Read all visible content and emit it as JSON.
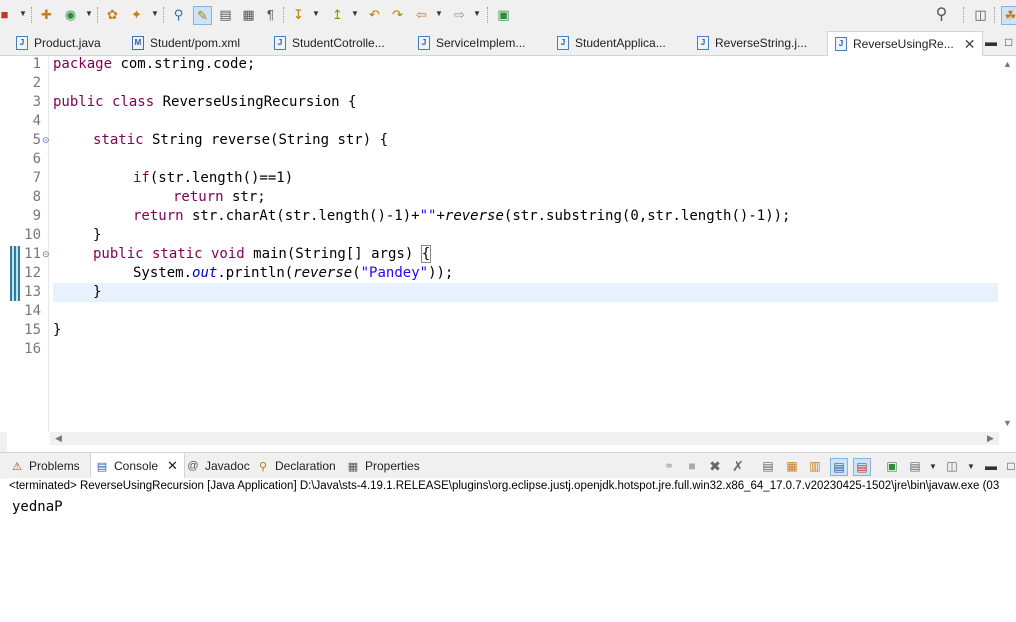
{
  "toolbar": {
    "icons": [
      "new-icon",
      "new-java-project-icon",
      "run-last-icon",
      "open-type-icon",
      "open-task-icon",
      "search-references-icon",
      "toggle-mark-occurrences-icon",
      "toggle-block-selection-icon",
      "show-whitespace-icon",
      "paragraph-icon",
      "next-annotation-icon",
      "prev-annotation-icon",
      "last-edit-icon",
      "back-icon",
      "forward-icon",
      "pin-editor-icon",
      "search-icon",
      "open-perspective-icon",
      "java-perspective-icon"
    ]
  },
  "editor_tabs": [
    {
      "label": "Product.java",
      "icon": "J"
    },
    {
      "label": "Student/pom.xml",
      "icon": "M"
    },
    {
      "label": "StudentCotrolle...",
      "icon": "J"
    },
    {
      "label": "ServiceImplem...",
      "icon": "J"
    },
    {
      "label": "StudentApplica...",
      "icon": "J"
    },
    {
      "label": "ReverseString.j...",
      "icon": "J"
    },
    {
      "label": "ReverseUsingRe...",
      "icon": "J",
      "active": true
    }
  ],
  "editor": {
    "line_numbers": [
      "1",
      "2",
      "3",
      "4",
      "5",
      "6",
      "7",
      "8",
      "9",
      "10",
      "11",
      "12",
      "13",
      "14",
      "15",
      "16"
    ],
    "code": {
      "l1_kw": "package",
      "l1_rest": " com.string.code;",
      "l3_kw": "public class",
      "l3_rest": " ReverseUsingRecursion {",
      "l5_kw": "static",
      "l5_rest": " String reverse(String str) {",
      "l7_kw": "if",
      "l7_rest": "(str.length()==1)",
      "l8_kw": "return",
      "l8_rest": " str;",
      "l9_kw": "return",
      "l9_a": " str.charAt(str.length()-1)+",
      "l9_str": "\"\"",
      "l9_b": "+",
      "l9_it": "reverse",
      "l9_c": "(str.substring(0,str.length()-1));",
      "l10": "}",
      "l11_kw": "public static void",
      "l11_rest": " main(String[] args) ",
      "l11_brace": "{",
      "l12_a": "System.",
      "l12_field": "out",
      "l12_b": ".println(",
      "l12_it": "reverse",
      "l12_c": "(",
      "l12_str": "\"Pandey\"",
      "l12_d": "));",
      "l13": "}",
      "l15": "}"
    }
  },
  "panel": {
    "tabs": [
      {
        "label": "Problems",
        "icon": "problems-icon"
      },
      {
        "label": "Console",
        "icon": "console-icon",
        "active": true
      },
      {
        "label": "Javadoc",
        "icon": "javadoc-icon"
      },
      {
        "label": "Declaration",
        "icon": "declaration-icon"
      },
      {
        "label": "Properties",
        "icon": "properties-icon"
      }
    ],
    "status": "<terminated> ReverseUsingRecursion [Java Application] D:\\Java\\sts-4.19.1.RELEASE\\plugins\\org.eclipse.justj.openjdk.hotspot.jre.full.win32.x86_64_17.0.7.v20230425-1502\\jre\\bin\\javaw.exe  (03",
    "output": "yednaP"
  },
  "colors": {
    "keyword": "#7f0055",
    "string": "#2a00ff",
    "field": "#0000c0",
    "current_line": "#e8f2fe"
  }
}
